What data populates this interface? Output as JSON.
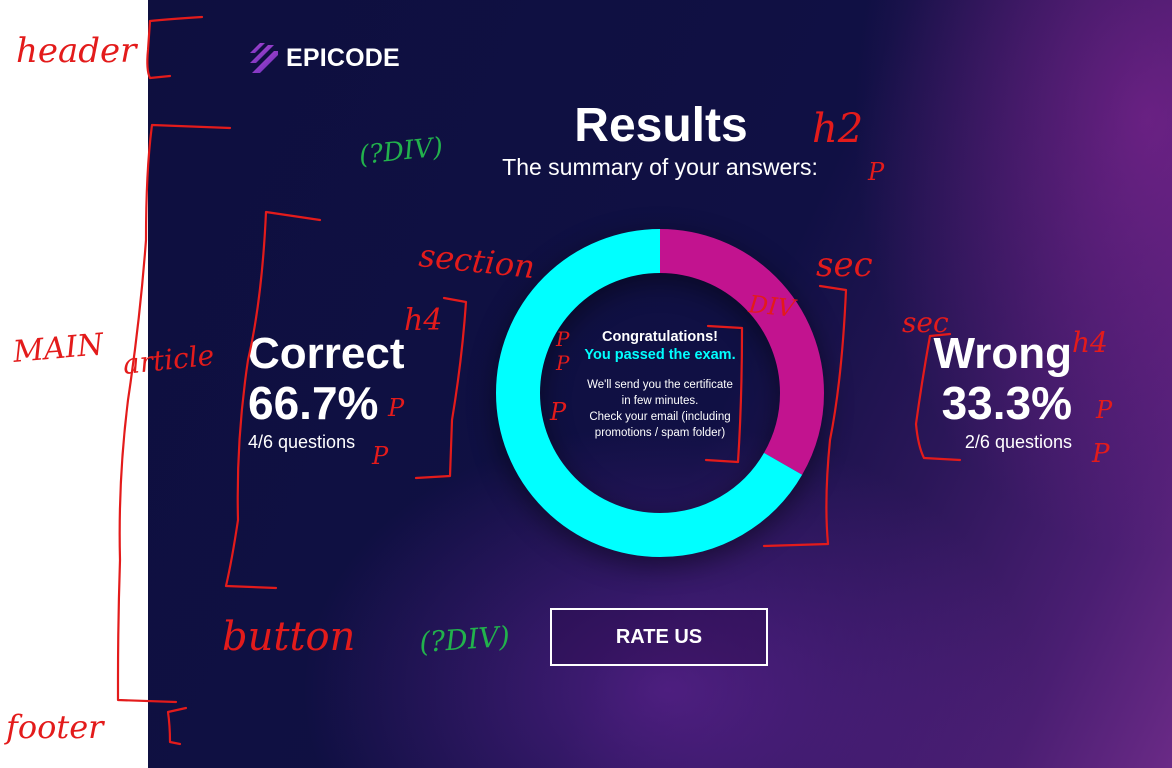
{
  "brand": {
    "name": "EPICODE",
    "logo_icon": "epicode-stripes-icon"
  },
  "header": {
    "title": "Results",
    "subtitle": "The summary of your answers:"
  },
  "results": {
    "correct": {
      "label": "Correct",
      "percent": "66.7%",
      "count": "4/6 questions"
    },
    "wrong": {
      "label": "Wrong",
      "percent": "33.3%",
      "count": "2/6 questions"
    }
  },
  "chart_data": {
    "type": "pie",
    "categories": [
      "Correct",
      "Wrong"
    ],
    "values": [
      66.7,
      33.3
    ],
    "colors": [
      "#00ffff",
      "#c2138f"
    ]
  },
  "center_message": {
    "congrats": "Congratulations!",
    "passed": "You passed the exam.",
    "note": "We'll send you the certificate\nin few minutes.\nCheck your email (including\npromotions / spam folder)"
  },
  "button": {
    "rate_label": "RATE US"
  },
  "annotations": {
    "header": "header",
    "main": "MAIN",
    "article": "article",
    "footer": "footer",
    "h2": "h2",
    "div_q1": "(?DIV)",
    "section": "section",
    "sec_right": "sec",
    "sec_wrong": "sec",
    "div_center": "DIV",
    "h4_left": "h4",
    "h4_right": "h4",
    "p": "P",
    "button": "button",
    "div_q2": "(?DIV)"
  },
  "colors": {
    "bg_dark": "#0e0f3f",
    "accent_cyan": "#00ffff",
    "accent_magenta": "#c2138f",
    "annotation_red": "#e31b1b",
    "annotation_green": "#22b24c"
  }
}
